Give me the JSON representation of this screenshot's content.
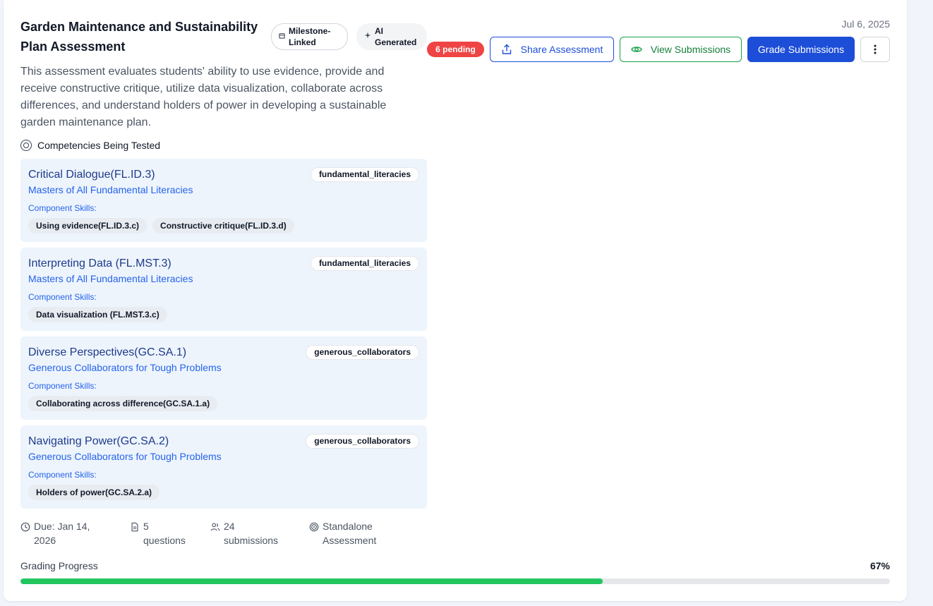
{
  "assessment": {
    "title": "Garden Maintenance and Sustainability Plan Assessment",
    "badges": {
      "milestone": "Milestone-Linked",
      "ai": "AI Generated"
    },
    "description": "This assessment evaluates students' ability to use evidence, provide and receive constructive critique, utilize data visualization, collaborate across differences, and understand holders of power in developing a sustainable garden maintenance plan.",
    "date": "Jul 6, 2025",
    "pending_badge": "6 pending"
  },
  "actions": {
    "share_label": "Share Assessment",
    "view_label": "View Submissions",
    "grade_label": "Grade Submissions",
    "more_icon": "more-vertical-icon"
  },
  "competencies_header": "Competencies Being Tested",
  "competencies": [
    {
      "name": "Critical Dialogue(FL.ID.3)",
      "subtitle": "Masters of All Fundamental Literacies",
      "category": "fundamental_literacies",
      "skills_label": "Component Skills:",
      "skills": [
        "Using evidence(FL.ID.3.c)",
        "Constructive critique(FL.ID.3.d)"
      ]
    },
    {
      "name": "Interpreting Data (FL.MST.3)",
      "subtitle": "Masters of All Fundamental Literacies",
      "category": "fundamental_literacies",
      "skills_label": "Component Skills:",
      "skills": [
        "Data visualization (FL.MST.3.c)"
      ]
    },
    {
      "name": "Diverse Perspectives(GC.SA.1)",
      "subtitle": "Generous Collaborators for Tough Problems",
      "category": "generous_collaborators",
      "skills_label": "Component Skills:",
      "skills": [
        "Collaborating across difference(GC.SA.1.a)"
      ]
    },
    {
      "name": "Navigating Power(GC.SA.2)",
      "subtitle": "Generous Collaborators for Tough Problems",
      "category": "generous_collaborators",
      "skills_label": "Component Skills:",
      "skills": [
        "Holders of power(GC.SA.2.a)"
      ]
    }
  ],
  "meta": {
    "due_line1": "Due: Jan 14,",
    "due_line2": "2026",
    "questions_line1": "5",
    "questions_line2": "questions",
    "submissions_line1": "24",
    "submissions_line2": "submissions",
    "type_line1": "Standalone",
    "type_line2": "Assessment"
  },
  "progress": {
    "label": "Grading Progress",
    "percent_text": "67%",
    "fraction": 0.67
  },
  "colors": {
    "primary": "#1d4ed8",
    "success": "#16a34a",
    "danger": "#ef4444",
    "competency_bg": "#edf4fc"
  }
}
